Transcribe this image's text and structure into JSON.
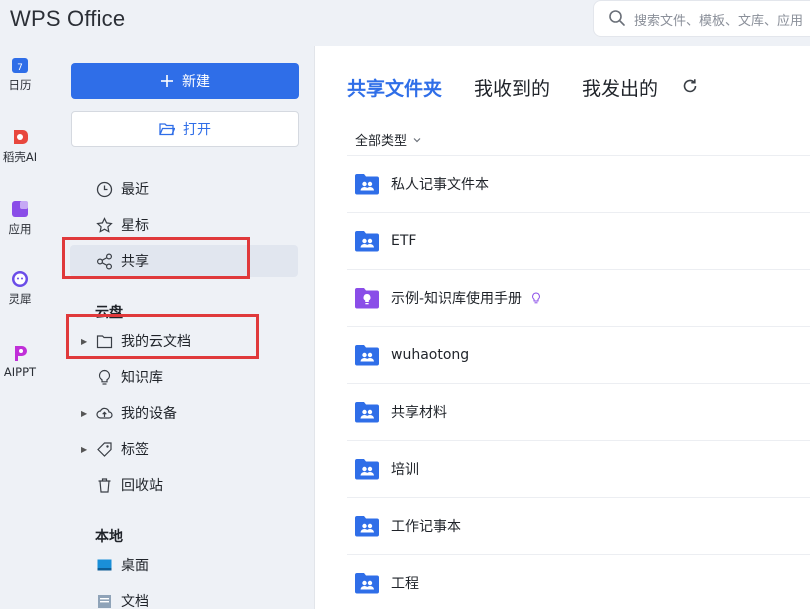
{
  "app": {
    "title": "WPS Office"
  },
  "search": {
    "placeholder": "搜索文件、模板、文库、应用"
  },
  "rail": {
    "items": [
      {
        "label": "日历",
        "icon": "calendar-icon",
        "color": "#2f6ee8"
      },
      {
        "label": "稻壳AI",
        "icon": "docer-ai-icon",
        "color": "#e8473d"
      },
      {
        "label": "应用",
        "icon": "apps-icon",
        "color": "#8a4de8"
      },
      {
        "label": "灵犀",
        "icon": "lingxi-icon",
        "color": "#6b4de8"
      },
      {
        "label": "AIPPT",
        "icon": "aippt-icon",
        "color": "#c02fd8"
      }
    ]
  },
  "nav": {
    "new_label": "新建",
    "open_label": "打开",
    "items": [
      {
        "label": "最近",
        "icon": "clock-icon"
      },
      {
        "label": "星标",
        "icon": "star-icon"
      },
      {
        "label": "共享",
        "icon": "share-icon"
      }
    ],
    "cloud_title": "云盘",
    "cloud_items": [
      {
        "label": "我的云文档",
        "icon": "folder-icon"
      },
      {
        "label": "知识库",
        "icon": "knowledge-icon"
      },
      {
        "label": "我的设备",
        "icon": "cloud-upload-icon"
      },
      {
        "label": "标签",
        "icon": "tag-icon"
      },
      {
        "label": "回收站",
        "icon": "trash-icon"
      }
    ],
    "local_title": "本地",
    "local_items": [
      {
        "label": "桌面",
        "icon": "desktop-icon"
      },
      {
        "label": "文档",
        "icon": "document-icon"
      }
    ]
  },
  "main": {
    "tabs": [
      {
        "label": "共享文件夹",
        "active": true
      },
      {
        "label": "我收到的",
        "active": false
      },
      {
        "label": "我发出的",
        "active": false
      }
    ],
    "filter_label": "全部类型",
    "files": [
      {
        "name": "私人记事文件本",
        "icon": "shared-folder-icon",
        "color": "#2f6ee8"
      },
      {
        "name": "ETF",
        "icon": "shared-folder-icon",
        "color": "#2f6ee8"
      },
      {
        "name": "示例-知识库使用手册",
        "icon": "knowledge-folder-icon",
        "color": "#8a4de8"
      },
      {
        "name": "wuhaotong",
        "icon": "shared-folder-icon",
        "color": "#2f6ee8"
      },
      {
        "name": "共享材料",
        "icon": "shared-folder-icon",
        "color": "#2f6ee8"
      },
      {
        "name": "培训",
        "icon": "shared-folder-icon",
        "color": "#2f6ee8"
      },
      {
        "name": "工作记事本",
        "icon": "shared-folder-icon",
        "color": "#2f6ee8"
      },
      {
        "name": "工程",
        "icon": "shared-folder-icon",
        "color": "#2f6ee8"
      }
    ]
  },
  "colors": {
    "accent": "#2f6ee8",
    "highlight": "#e0393b",
    "panel": "#eef1f6"
  }
}
